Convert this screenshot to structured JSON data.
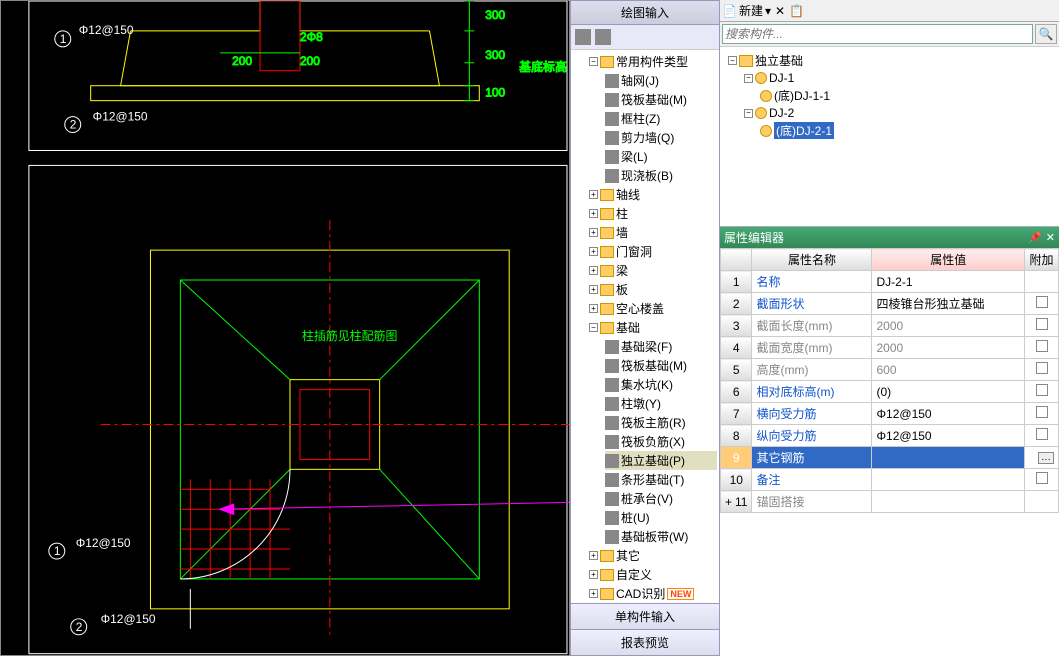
{
  "cad": {
    "topDrawing": {
      "leftLabel": "Φ12@150",
      "rightLabel": "2Φ8",
      "dim200L": "200",
      "dim200R": "200",
      "dim300": "300",
      "dim300b": "300",
      "dim100": "100",
      "note": "基底标高",
      "bubble1": "1",
      "bubble2": "2",
      "bottomLabel": "Φ12@150"
    },
    "bottomDrawing": {
      "note": "柱插筋见柱配筋图",
      "bubble1": "1",
      "bubble2": "2",
      "label1": "Φ12@150",
      "label2": "Φ12@150"
    }
  },
  "midPanel": {
    "header1": "绘图输入",
    "items": {
      "common": "常用构件类型",
      "axisGrid": "轴网(J)",
      "raftFoundation": "筏板基础(M)",
      "frameCol": "框柱(Z)",
      "shearWall": "剪力墙(Q)",
      "beam": "梁(L)",
      "castSlab": "现浇板(B)",
      "axis": "轴线",
      "column": "柱",
      "wall": "墙",
      "doorWindow": "门窗洞",
      "beamF": "梁",
      "slab": "板",
      "hollowFloor": "空心楼盖",
      "foundation": "基础",
      "foundBeam": "基础梁(F)",
      "raftFound2": "筏板基础(M)",
      "sump": "集水坑(K)",
      "pillarPier": "柱墩(Y)",
      "raftMain": "筏板主筋(R)",
      "raftNeg": "筏板负筋(X)",
      "isoFoot": "独立基础(P)",
      "stripFoot": "条形基础(T)",
      "pileCap": "桩承台(V)",
      "pile": "桩(U)",
      "footBand": "基础板带(W)",
      "other": "其它",
      "custom": "自定义",
      "cadRec": "CAD识别"
    },
    "footer1": "单构件输入",
    "footer2": "报表预览"
  },
  "rightPanel": {
    "topBar": {
      "new": "新建"
    },
    "searchPlaceholder": "搜索构件...",
    "compTree": {
      "root": "独立基础",
      "dj1": "DJ-1",
      "dj11": "(底)DJ-1-1",
      "dj2": "DJ-2",
      "dj21": "(底)DJ-2-1"
    },
    "propHeader": "属性编辑器",
    "headers": {
      "name": "属性名称",
      "value": "属性值",
      "attach": "附加"
    },
    "rows": [
      {
        "n": "1",
        "name": "名称",
        "val": "DJ-2-1",
        "cls": "prop-name"
      },
      {
        "n": "2",
        "name": "截面形状",
        "val": "四棱锥台形独立基础",
        "cls": "prop-name"
      },
      {
        "n": "3",
        "name": "截面长度(mm)",
        "val": "2000",
        "cls": "readonly"
      },
      {
        "n": "4",
        "name": "截面宽度(mm)",
        "val": "2000",
        "cls": "readonly"
      },
      {
        "n": "5",
        "name": "高度(mm)",
        "val": "600",
        "cls": "readonly"
      },
      {
        "n": "6",
        "name": "相对底标高(m)",
        "val": "(0)",
        "cls": "prop-name"
      },
      {
        "n": "7",
        "name": "横向受力筋",
        "val": "Φ12@150",
        "cls": "prop-name"
      },
      {
        "n": "8",
        "name": "纵向受力筋",
        "val": "Φ12@150",
        "cls": "prop-name"
      },
      {
        "n": "9",
        "name": "其它钢筋",
        "val": "",
        "cls": "sel"
      },
      {
        "n": "10",
        "name": "备注",
        "val": "",
        "cls": "prop-name"
      },
      {
        "n": "11",
        "name": "锚固搭接",
        "val": "",
        "cls": "readonly",
        "exp": true
      }
    ]
  }
}
